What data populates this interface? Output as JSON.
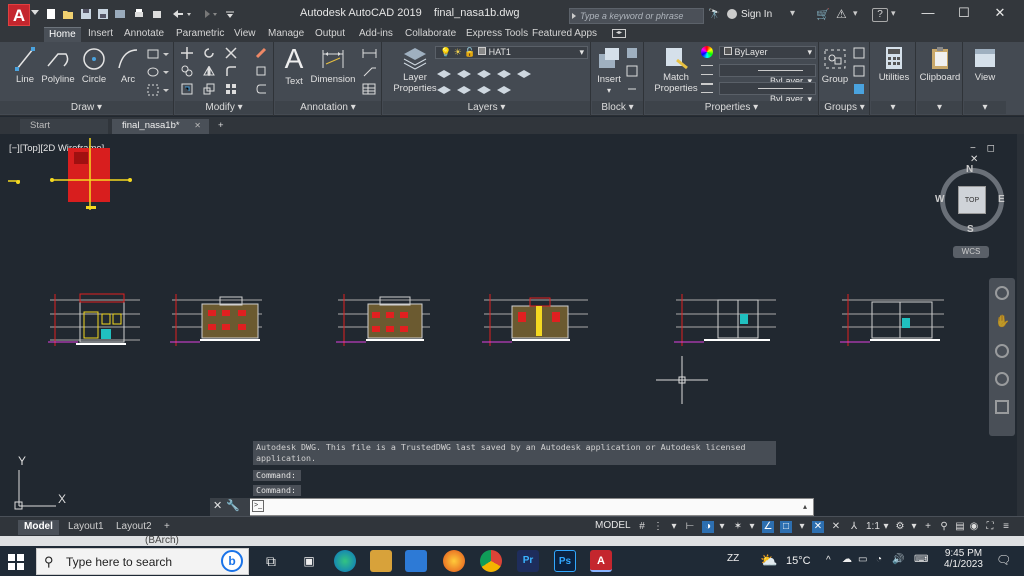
{
  "titlebar": {
    "app_letter": "A",
    "title": "Autodesk AutoCAD 2019    final_nasa1b.dwg",
    "search_placeholder": "Type a keyword or phrase",
    "signin_label": "Sign In",
    "help_label": "?",
    "min_label": "—",
    "max_label": "☐",
    "close_label": "✕"
  },
  "ribbon_tabs": [
    "Home",
    "Insert",
    "Annotate",
    "Parametric",
    "View",
    "Manage",
    "Output",
    "Add-ins",
    "Collaborate",
    "Express Tools",
    "Featured Apps"
  ],
  "ribbon": {
    "draw": {
      "title": "Draw",
      "tools": [
        "Line",
        "Polyline",
        "Circle",
        "Arc"
      ]
    },
    "modify": {
      "title": "Modify"
    },
    "annotation": {
      "title": "Annotation",
      "text_label": "Text",
      "dimension_label": "Dimension"
    },
    "layers": {
      "title": "Layers",
      "layer_properties": "Layer Properties",
      "current_layer": "HAT1"
    },
    "block": {
      "title": "Block",
      "insert_label": "Insert"
    },
    "properties": {
      "title": "Properties",
      "match_label": "Match Properties",
      "color": "ByLayer",
      "linetype": "ByLayer",
      "lineweight": "ByLayer"
    },
    "groups": {
      "title": "Groups",
      "group_label": "Group"
    },
    "utilities_label": "Utilities",
    "clipboard_label": "Clipboard",
    "view_label": "View"
  },
  "file_tabs": {
    "start": "Start",
    "current": "final_nasa1b*",
    "close": "✕",
    "new": "+"
  },
  "canvas": {
    "viewport_label": "[−][Top][2D Wireframe]",
    "viewport_controls": "− ◻ ✕",
    "viewcube": {
      "top_label": "TOP",
      "north": "N",
      "south": "S",
      "east": "E",
      "west": "W",
      "wcs_label": "WCS"
    },
    "ucs": {
      "y_label": "Y",
      "x_label": "X"
    }
  },
  "command": {
    "history": "Autodesk DWG.  This file is a TrustedDWG last saved by an Autodesk application or Autodesk licensed application.",
    "line1": "Command:",
    "line2": "Command:",
    "input_placeholder": ""
  },
  "layout_tabs": {
    "model": "Model",
    "layout1": "Layout1",
    "layout2": "Layout2",
    "add": "+"
  },
  "status": {
    "model_label": "MODEL",
    "scale": "1:1"
  },
  "behind_text": "(BArch)",
  "taskbar": {
    "search_placeholder": "Type here to search",
    "temperature": "15°C",
    "time": "9:45 PM",
    "date": "4/1/2023",
    "zz_label": "ZZ"
  },
  "colors": {
    "accent_autocad": "#c4262e",
    "canvas_bg": "#212830",
    "ribbon_bg": "#444a52",
    "taskbar_bg": "#1f2a36"
  }
}
